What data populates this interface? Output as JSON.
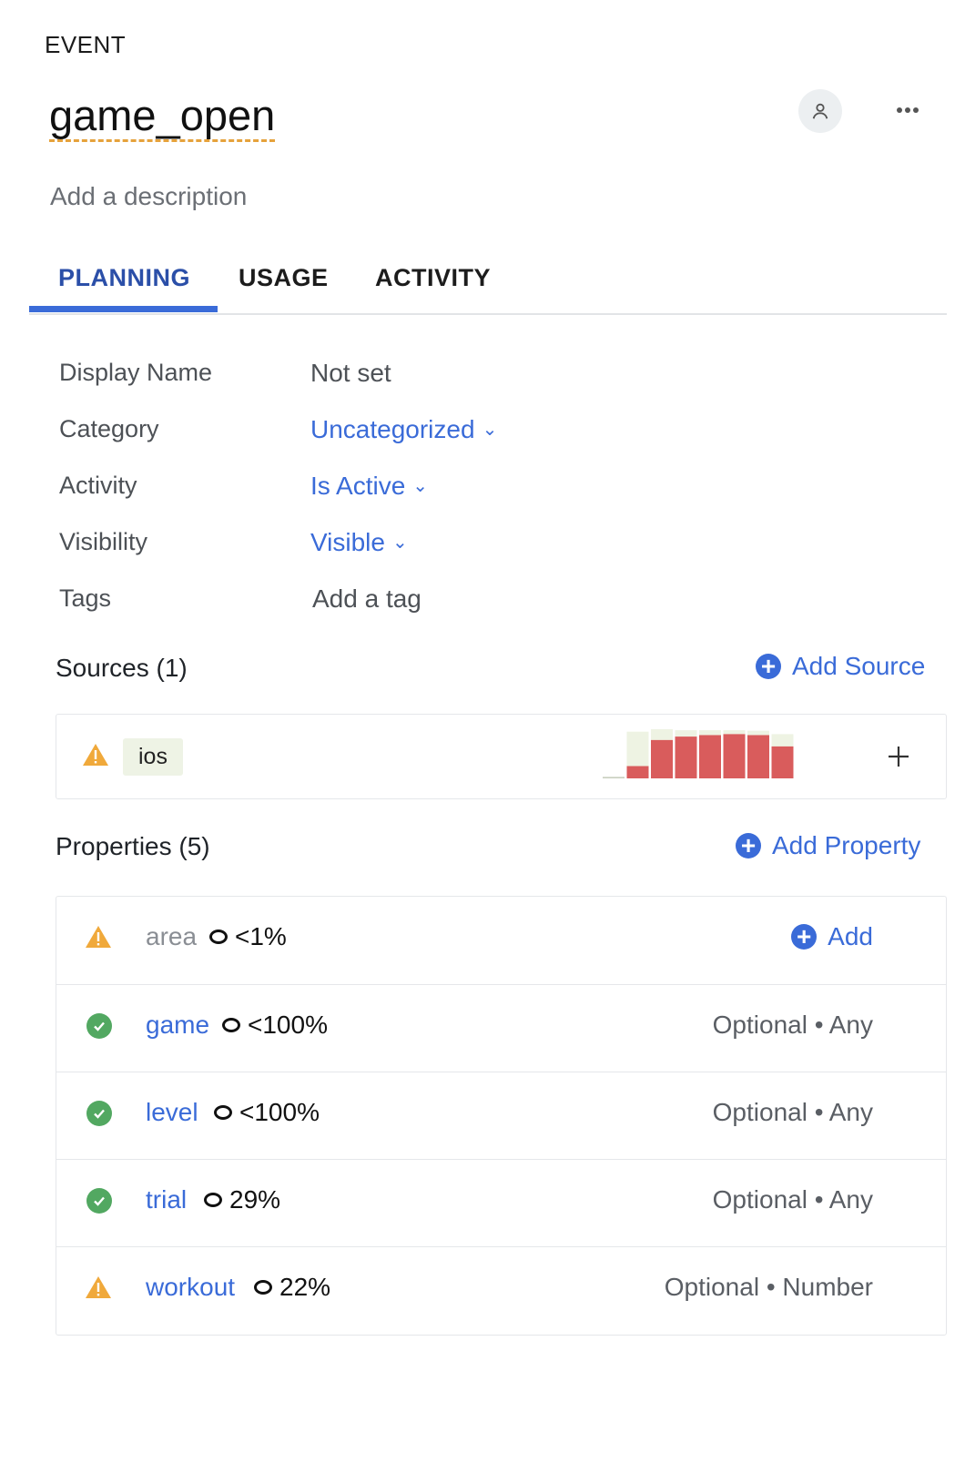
{
  "header": {
    "eyebrow": "EVENT",
    "title": "game_open",
    "description_placeholder": "Add a description"
  },
  "tabs": [
    {
      "label": "PLANNING",
      "active": true
    },
    {
      "label": "USAGE",
      "active": false
    },
    {
      "label": "ACTIVITY",
      "active": false
    }
  ],
  "fields": {
    "display_name": {
      "label": "Display Name",
      "value": "Not set"
    },
    "category": {
      "label": "Category",
      "value": "Uncategorized"
    },
    "activity": {
      "label": "Activity",
      "value": "Is Active"
    },
    "visibility": {
      "label": "Visibility",
      "value": "Visible"
    },
    "tags": {
      "label": "Tags",
      "value": "Add a tag"
    }
  },
  "sources": {
    "title": "Sources (1)",
    "add_label": "Add Source",
    "items": [
      {
        "name": "ios",
        "status": "warning",
        "sparkline": [
          {
            "total": 0.03,
            "value": 0.03
          },
          {
            "total": 0.95,
            "value": 0.25
          },
          {
            "total": 1.0,
            "value": 0.78
          },
          {
            "total": 0.98,
            "value": 0.85
          },
          {
            "total": 0.98,
            "value": 0.88
          },
          {
            "total": 0.98,
            "value": 0.9
          },
          {
            "total": 0.97,
            "value": 0.88
          },
          {
            "total": 0.9,
            "value": 0.65
          }
        ]
      }
    ]
  },
  "properties": {
    "title": "Properties (5)",
    "add_label": "Add Property",
    "items": [
      {
        "name": "area",
        "status": "warning",
        "pct": "<1%",
        "meta": "",
        "action": "Add"
      },
      {
        "name": "game",
        "status": "ok",
        "pct": "<100%",
        "meta": "Optional • Any"
      },
      {
        "name": "level",
        "status": "ok",
        "pct": "<100%",
        "meta": "Optional • Any"
      },
      {
        "name": "trial",
        "status": "ok",
        "pct": "29%",
        "meta": "Optional • Any"
      },
      {
        "name": "workout",
        "status": "warning",
        "pct": "22%",
        "meta": "Optional • Number"
      }
    ]
  },
  "colors": {
    "accent": "#3a6bd8",
    "warning": "#f0a93b",
    "ok": "#52a861",
    "spark_bar": "#d95c5c",
    "spark_bg": "#eef3e3"
  }
}
